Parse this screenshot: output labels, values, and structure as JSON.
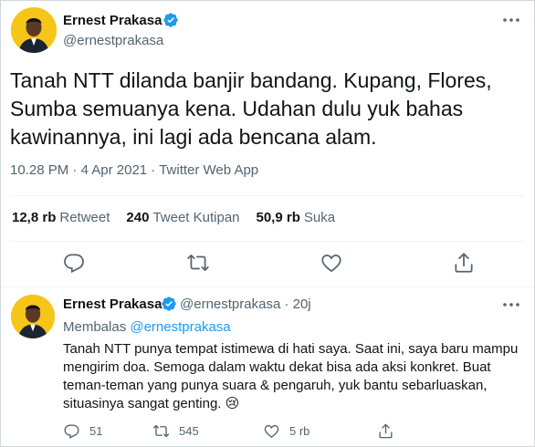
{
  "main_tweet": {
    "author_name": "Ernest Prakasa",
    "author_handle": "@ernestprakasa",
    "text": "Tanah NTT dilanda banjir bandang. Kupang, Flores, Sumba semuanya kena. Udahan dulu yuk bahas kawinannya, ini lagi ada bencana alam.",
    "time": "10.28 PM",
    "date": "4 Apr 2021",
    "source": "Twitter Web App",
    "separator": " · ",
    "stats": [
      {
        "value": "12,8 rb",
        "label": "Retweet"
      },
      {
        "value": "240",
        "label": "Tweet Kutipan"
      },
      {
        "value": "50,9 rb",
        "label": "Suka"
      }
    ],
    "icons": {
      "reply": "reply-icon",
      "retweet": "retweet-icon",
      "like": "heart-icon",
      "share": "share-icon",
      "more": "more-icon",
      "verified": "verified-badge-icon"
    }
  },
  "reply_tweet": {
    "author_name": "Ernest Prakasa",
    "author_handle": "@ernestprakasa",
    "time_ago": "20j",
    "separator": " · ",
    "replying_prefix": "Membalas ",
    "replying_to": "@ernestprakasa",
    "text": "Tanah NTT punya tempat istimewa di hati saya. Saat ini, saya baru mampu mengirim doa. Semoga dalam waktu dekat bisa ada aksi konkret. Buat teman-teman yang punya suara & pengaruh, yuk bantu sebarluaskan, situasinya sangat genting. 😢",
    "counts": {
      "reply": "51",
      "retweet": "545",
      "like": "5 rb"
    }
  },
  "colors": {
    "accent": "#1d9bf0",
    "secondary_text": "#536471",
    "avatar_bg": "#f5c518"
  }
}
